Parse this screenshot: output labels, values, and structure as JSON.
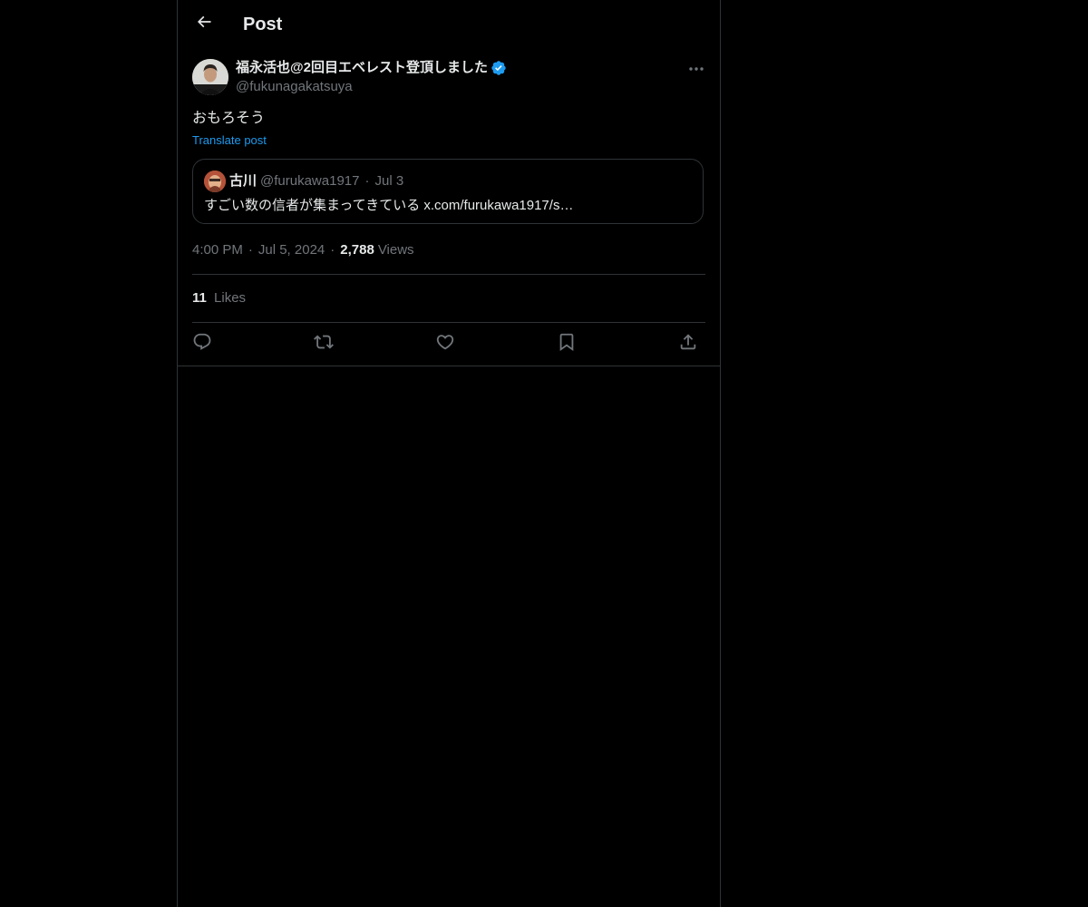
{
  "header": {
    "title": "Post",
    "back_icon": "arrow-left-icon"
  },
  "post": {
    "author": {
      "name": "福永活也@2回目エベレスト登頂しました",
      "handle": "@fukunagakatsuya",
      "verified": true,
      "verified_color": "#1d9bf0"
    },
    "text": "おもろそう",
    "translate_label": "Translate post",
    "quote": {
      "name": "古川",
      "handle": "@furukawa1917",
      "separator": "·",
      "date": "Jul 3",
      "text": "すごい数の信者が集まってきている x.com/furukawa1917/s…"
    },
    "time": "4:00 PM",
    "date": "Jul 5, 2024",
    "separator": "·",
    "views_count": "2,788",
    "views_label": "Views",
    "likes_count": "11",
    "likes_label": "Likes"
  },
  "actions": [
    {
      "name": "reply",
      "icon": "reply-icon"
    },
    {
      "name": "repost",
      "icon": "repost-icon"
    },
    {
      "name": "like",
      "icon": "heart-icon"
    },
    {
      "name": "bookmark",
      "icon": "bookmark-icon"
    },
    {
      "name": "share",
      "icon": "share-icon"
    }
  ],
  "colors": {
    "background": "#000000",
    "text_primary": "#e7e9ea",
    "text_secondary": "#71767b",
    "border": "#2f3336",
    "accent": "#1d9bf0"
  }
}
